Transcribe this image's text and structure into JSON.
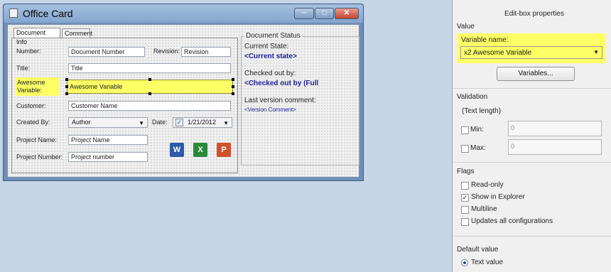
{
  "window": {
    "title": "Office Card",
    "minimize_icon": "minimize-icon",
    "maximize_icon": "maximize-icon",
    "close_icon": "close-icon"
  },
  "tabs": [
    {
      "label": "Document Info"
    },
    {
      "label": "Comment"
    }
  ],
  "form": {
    "number_label": "Number:",
    "number_value": "Document Number",
    "revision_label": "Revision:",
    "revision_value": "Revision",
    "title_label": "Title:",
    "title_value": "Title",
    "awesome_label_line1": "Awesome",
    "awesome_label_line2": "Variable:",
    "awesome_value": "Awesome Variable",
    "customer_label": "Customer:",
    "customer_value": "Customer Name",
    "created_by_label": "Created By:",
    "created_by_value": "Author",
    "date_label": "Date:",
    "date_value": "1/21/2012",
    "project_name_label": "Project Name:",
    "project_name_value": "Project Name",
    "project_number_label": "Project Number:",
    "project_number_value": "Project number"
  },
  "app_icons": [
    {
      "name": "word-icon",
      "glyph": "W",
      "color": "#2a5aa8"
    },
    {
      "name": "excel-icon",
      "glyph": "X",
      "color": "#2a8a3a"
    },
    {
      "name": "powerpoint-icon",
      "glyph": "P",
      "color": "#d2502a"
    }
  ],
  "status": {
    "group_title": "Document Status",
    "current_state_label": "Current State:",
    "current_state_value": "<Current state>",
    "checked_out_label": "Checked out by:",
    "checked_out_value": "<Checked out by (Full",
    "last_comment_label": "Last version comment:",
    "last_comment_value": "<Version Comment>"
  },
  "panel": {
    "title": "Edit-box properties",
    "value_section": "Value",
    "variable_name_label": "Variable name:",
    "variable_name_value": "x2 Awesome Variable",
    "variables_button": "Variables...",
    "validation_section": "Validation",
    "text_length_label": "(Text length)",
    "min_label": "Min:",
    "min_value": "0",
    "max_label": "Max:",
    "max_value": "0",
    "flags_section": "Flags",
    "flags": [
      {
        "label": "Read-only",
        "checked": false
      },
      {
        "label": "Show in Explorer",
        "checked": true
      },
      {
        "label": "Multiline",
        "checked": false
      },
      {
        "label": "Updates all configurations",
        "checked": false
      }
    ],
    "default_value_section": "Default value",
    "text_value_option": "Text value"
  },
  "colors": {
    "highlight": "#ffff66",
    "status_blue": "#1a1a9a"
  }
}
